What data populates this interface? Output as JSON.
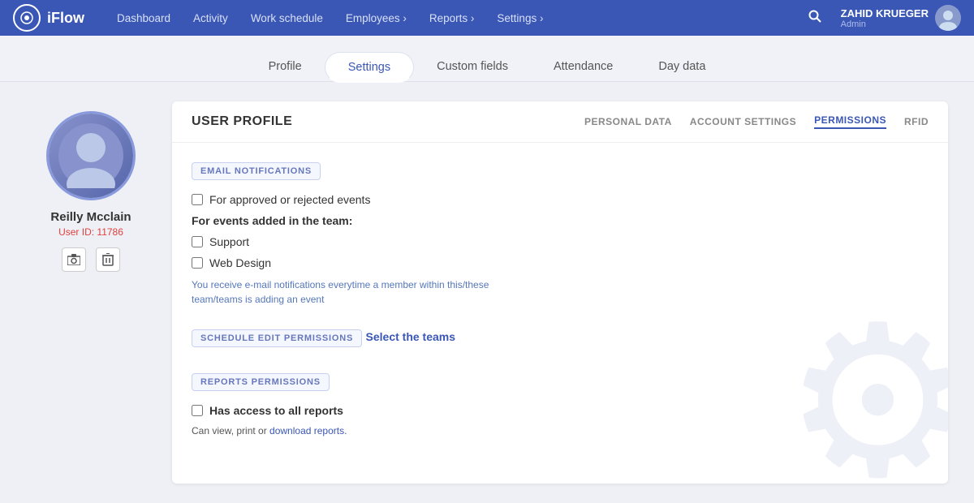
{
  "app": {
    "logo_text": "iFlow",
    "logo_icon": "🔵"
  },
  "nav": {
    "links": [
      {
        "label": "Dashboard",
        "has_arrow": false
      },
      {
        "label": "Activity",
        "has_arrow": false
      },
      {
        "label": "Work schedule",
        "has_arrow": false
      },
      {
        "label": "Employees",
        "has_arrow": true
      },
      {
        "label": "Reports",
        "has_arrow": true
      },
      {
        "label": "Settings",
        "has_arrow": true
      }
    ],
    "search_icon": "🔍",
    "user": {
      "name": "ZAHID KRUEGER",
      "role": "Admin"
    }
  },
  "tabs": [
    {
      "label": "Profile",
      "active": false
    },
    {
      "label": "Settings",
      "active": true
    },
    {
      "label": "Custom fields",
      "active": false
    },
    {
      "label": "Attendance",
      "active": false
    },
    {
      "label": "Day data",
      "active": false
    }
  ],
  "sidebar": {
    "user_name": "Reilly Mcclain",
    "user_id_label": "User ID: ",
    "user_id_number": "11786",
    "photo_btn_label": "📷",
    "delete_btn_label": "🗑"
  },
  "card": {
    "title": "USER PROFILE",
    "nav_items": [
      {
        "label": "PERSONAL DATA",
        "active": false
      },
      {
        "label": "ACCOUNT SETTINGS",
        "active": false
      },
      {
        "label": "PERMISSIONS",
        "active": true
      },
      {
        "label": "RFID",
        "active": false
      }
    ],
    "sections": {
      "email_notifications": {
        "label": "EMAIL NOTIFICATIONS",
        "for_approved": {
          "checked": false,
          "text": "For approved or rejected events"
        },
        "for_team_label": "For events added in the team:",
        "teams": [
          {
            "label": "Support",
            "checked": false
          },
          {
            "label": "Web Design",
            "checked": false
          }
        ],
        "help_text": "You receive e-mail notifications everytime a member within this/these team/teams is adding an event"
      },
      "schedule_edit": {
        "label": "SCHEDULE EDIT PERMISSIONS",
        "select_link": "Select the teams"
      },
      "reports_permissions": {
        "label": "REPORTS PERMISSIONS",
        "has_access": {
          "checked": false,
          "text": "Has access to all reports"
        },
        "can_view_text": "Can view, print or ",
        "download_link": "download reports."
      }
    }
  }
}
